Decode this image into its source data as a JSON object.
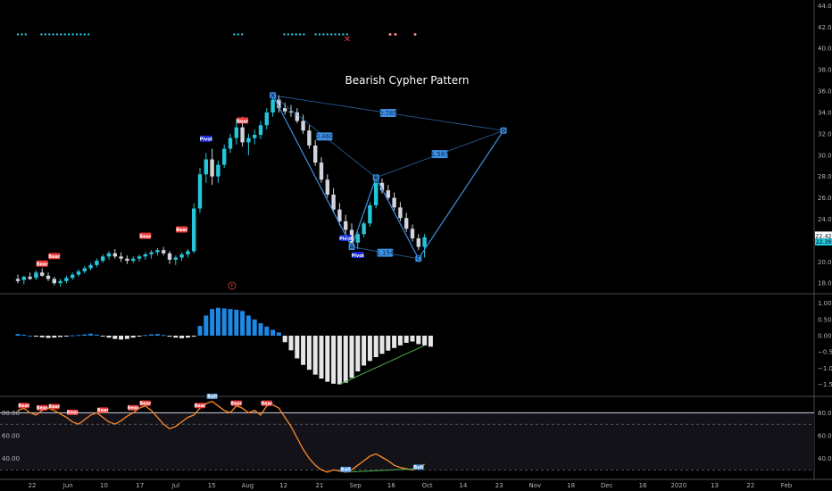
{
  "chart_data": [
    {
      "type": "line",
      "panel": "price",
      "title": "Bearish Cypher Pattern",
      "y_ticks": [
        "44.00",
        "42.00",
        "40.00",
        "38.00",
        "36.00",
        "34.00",
        "32.00",
        "30.00",
        "28.00",
        "26.00",
        "24.00",
        "22.00",
        "20.00",
        "18.00"
      ],
      "ylim": [
        17.6,
        44.2
      ],
      "last_price_label": "22.42",
      "last_price": 22.42,
      "secondary_price_label": "22.39",
      "secondary_price": 22.2,
      "candles": [
        {
          "o": 18.4,
          "h": 18.8,
          "l": 18.0,
          "c": 18.2
        },
        {
          "o": 18.3,
          "h": 18.7,
          "l": 17.9,
          "c": 18.6
        },
        {
          "o": 18.6,
          "h": 19.0,
          "l": 18.3,
          "c": 18.4
        },
        {
          "o": 18.5,
          "h": 19.2,
          "l": 18.3,
          "c": 19.0
        },
        {
          "o": 19.0,
          "h": 19.4,
          "l": 18.6,
          "c": 18.7
        },
        {
          "o": 18.7,
          "h": 19.0,
          "l": 18.2,
          "c": 18.4
        },
        {
          "o": 18.4,
          "h": 18.6,
          "l": 17.8,
          "c": 18.0
        },
        {
          "o": 18.0,
          "h": 18.4,
          "l": 17.7,
          "c": 18.2
        },
        {
          "o": 18.2,
          "h": 18.7,
          "l": 18.0,
          "c": 18.5
        },
        {
          "o": 18.5,
          "h": 19.0,
          "l": 18.3,
          "c": 18.8
        },
        {
          "o": 18.8,
          "h": 19.3,
          "l": 18.6,
          "c": 19.1
        },
        {
          "o": 19.1,
          "h": 19.6,
          "l": 18.9,
          "c": 19.4
        },
        {
          "o": 19.4,
          "h": 19.9,
          "l": 19.2,
          "c": 19.7
        },
        {
          "o": 19.7,
          "h": 20.3,
          "l": 19.5,
          "c": 20.1
        },
        {
          "o": 20.1,
          "h": 20.7,
          "l": 19.9,
          "c": 20.5
        },
        {
          "o": 20.5,
          "h": 21.0,
          "l": 20.2,
          "c": 20.8
        },
        {
          "o": 20.8,
          "h": 21.2,
          "l": 20.3,
          "c": 20.5
        },
        {
          "o": 20.5,
          "h": 20.9,
          "l": 20.0,
          "c": 20.3
        },
        {
          "o": 20.3,
          "h": 20.6,
          "l": 19.8,
          "c": 20.1
        },
        {
          "o": 20.1,
          "h": 20.5,
          "l": 19.9,
          "c": 20.3
        },
        {
          "o": 20.3,
          "h": 20.7,
          "l": 20.0,
          "c": 20.5
        },
        {
          "o": 20.5,
          "h": 20.9,
          "l": 20.2,
          "c": 20.7
        },
        {
          "o": 20.7,
          "h": 21.1,
          "l": 20.3,
          "c": 20.9
        },
        {
          "o": 20.9,
          "h": 21.3,
          "l": 20.6,
          "c": 21.1
        },
        {
          "o": 21.1,
          "h": 21.4,
          "l": 20.6,
          "c": 20.8
        },
        {
          "o": 20.8,
          "h": 21.0,
          "l": 19.8,
          "c": 20.2
        },
        {
          "o": 20.2,
          "h": 20.6,
          "l": 19.7,
          "c": 20.4
        },
        {
          "o": 20.4,
          "h": 20.9,
          "l": 20.1,
          "c": 20.7
        },
        {
          "o": 20.7,
          "h": 21.2,
          "l": 20.4,
          "c": 21.0
        },
        {
          "o": 21.0,
          "h": 25.5,
          "l": 20.8,
          "c": 25.0
        },
        {
          "o": 25.0,
          "h": 28.8,
          "l": 24.6,
          "c": 28.2
        },
        {
          "o": 28.2,
          "h": 30.2,
          "l": 27.4,
          "c": 29.6
        },
        {
          "o": 29.6,
          "h": 30.6,
          "l": 27.2,
          "c": 28.0
        },
        {
          "o": 28.0,
          "h": 29.5,
          "l": 27.4,
          "c": 29.1
        },
        {
          "o": 29.1,
          "h": 31.0,
          "l": 28.8,
          "c": 30.6
        },
        {
          "o": 30.6,
          "h": 32.0,
          "l": 30.2,
          "c": 31.6
        },
        {
          "o": 31.6,
          "h": 33.4,
          "l": 31.0,
          "c": 32.6
        },
        {
          "o": 32.6,
          "h": 33.6,
          "l": 30.8,
          "c": 31.2
        },
        {
          "o": 31.2,
          "h": 32.0,
          "l": 30.0,
          "c": 31.6
        },
        {
          "o": 31.6,
          "h": 32.4,
          "l": 31.0,
          "c": 31.9
        },
        {
          "o": 31.9,
          "h": 33.2,
          "l": 31.5,
          "c": 32.8
        },
        {
          "o": 32.8,
          "h": 34.4,
          "l": 32.4,
          "c": 34.0
        },
        {
          "o": 34.0,
          "h": 35.6,
          "l": 33.6,
          "c": 35.2
        },
        {
          "o": 35.2,
          "h": 35.6,
          "l": 34.0,
          "c": 34.4
        },
        {
          "o": 34.4,
          "h": 34.9,
          "l": 33.8,
          "c": 34.1
        },
        {
          "o": 34.1,
          "h": 34.7,
          "l": 33.6,
          "c": 34.0
        },
        {
          "o": 34.0,
          "h": 34.4,
          "l": 33.0,
          "c": 33.2
        },
        {
          "o": 33.2,
          "h": 33.8,
          "l": 32.0,
          "c": 32.3
        },
        {
          "o": 32.3,
          "h": 32.8,
          "l": 30.6,
          "c": 30.9
        },
        {
          "o": 30.9,
          "h": 31.4,
          "l": 29.0,
          "c": 29.3
        },
        {
          "o": 29.3,
          "h": 29.8,
          "l": 27.4,
          "c": 27.7
        },
        {
          "o": 27.7,
          "h": 28.2,
          "l": 26.0,
          "c": 26.3
        },
        {
          "o": 26.3,
          "h": 26.9,
          "l": 24.6,
          "c": 24.9
        },
        {
          "o": 24.9,
          "h": 25.5,
          "l": 23.4,
          "c": 23.8
        },
        {
          "o": 23.8,
          "h": 24.4,
          "l": 22.6,
          "c": 23.0
        },
        {
          "o": 23.0,
          "h": 23.6,
          "l": 21.4,
          "c": 21.8
        },
        {
          "o": 21.8,
          "h": 22.8,
          "l": 21.2,
          "c": 22.6
        },
        {
          "o": 22.6,
          "h": 23.8,
          "l": 22.3,
          "c": 23.6
        },
        {
          "o": 23.6,
          "h": 25.6,
          "l": 23.3,
          "c": 25.3
        },
        {
          "o": 25.3,
          "h": 27.8,
          "l": 25.0,
          "c": 27.4
        },
        {
          "o": 27.4,
          "h": 27.8,
          "l": 26.4,
          "c": 26.7
        },
        {
          "o": 26.7,
          "h": 27.2,
          "l": 25.8,
          "c": 26.0
        },
        {
          "o": 26.0,
          "h": 26.5,
          "l": 24.8,
          "c": 25.1
        },
        {
          "o": 25.1,
          "h": 25.6,
          "l": 23.8,
          "c": 24.1
        },
        {
          "o": 24.1,
          "h": 24.6,
          "l": 22.8,
          "c": 23.1
        },
        {
          "o": 23.1,
          "h": 23.5,
          "l": 21.9,
          "c": 22.2
        },
        {
          "o": 22.2,
          "h": 22.6,
          "l": 21.1,
          "c": 21.4
        },
        {
          "o": 21.4,
          "h": 22.6,
          "l": 20.4,
          "c": 22.3
        }
      ],
      "pattern": {
        "points": [
          {
            "label": "X",
            "i": 42,
            "y": 35.6
          },
          {
            "label": "A",
            "i": 55,
            "y": 21.4
          },
          {
            "label": "B",
            "i": 59,
            "y": 27.9
          },
          {
            "label": "C",
            "i": 66,
            "y": 20.3
          },
          {
            "label": "D",
            "i": 80,
            "y": 32.3
          }
        ],
        "ratios": [
          {
            "label": "0.460",
            "from": 0,
            "to": 2
          },
          {
            "label": "1.154",
            "from": 1,
            "to": 3
          },
          {
            "label": "1.587",
            "from": 2,
            "to": 4
          },
          {
            "label": "0.785",
            "from": 0,
            "to": 4
          }
        ]
      },
      "signal_tags": [
        {
          "label": "Bear",
          "i": 4,
          "y": 19.8,
          "kind": "bear"
        },
        {
          "label": "Bear",
          "i": 6,
          "y": 20.5,
          "kind": "bear"
        },
        {
          "label": "Bear",
          "i": 21,
          "y": 22.4,
          "kind": "bear"
        },
        {
          "label": "Bear",
          "i": 27,
          "y": 23.0,
          "kind": "bear"
        },
        {
          "label": "Pivot",
          "i": 31,
          "y": 31.5,
          "kind": "pivot"
        },
        {
          "label": "Bear",
          "i": 37,
          "y": 33.2,
          "kind": "bear"
        },
        {
          "label": "Pivot",
          "i": 54,
          "y": 22.2,
          "kind": "pivot"
        },
        {
          "label": "Pivot",
          "i": 56,
          "y": 20.6,
          "kind": "pivot"
        }
      ]
    },
    {
      "type": "bar",
      "panel": "histogram",
      "y_ticks": [
        "1.00",
        "0.50",
        "0.00",
        "−0.50",
        "−1.00",
        "−1.50"
      ],
      "ylim": [
        -1.65,
        1.1
      ],
      "values": [
        0.05,
        0.03,
        0.0,
        -0.03,
        -0.05,
        -0.07,
        -0.06,
        -0.04,
        -0.02,
        0.01,
        0.02,
        0.04,
        0.06,
        0.03,
        -0.02,
        -0.06,
        -0.1,
        -0.12,
        -0.1,
        -0.06,
        -0.02,
        0.02,
        0.04,
        0.05,
        0.02,
        -0.03,
        -0.06,
        -0.08,
        -0.06,
        -0.03,
        0.3,
        0.62,
        0.82,
        0.86,
        0.84,
        0.82,
        0.8,
        0.76,
        0.62,
        0.5,
        0.38,
        0.28,
        0.18,
        0.1,
        -0.2,
        -0.45,
        -0.7,
        -0.9,
        -1.05,
        -1.2,
        -1.32,
        -1.42,
        -1.48,
        -1.5,
        -1.45,
        -1.3,
        -1.1,
        -0.92,
        -0.78,
        -0.66,
        -0.56,
        -0.46,
        -0.38,
        -0.3,
        -0.22,
        -0.18,
        -0.26,
        -0.3,
        -0.34
      ],
      "divergence": {
        "from": 53,
        "to": 67
      }
    },
    {
      "type": "line",
      "panel": "rsi",
      "y_ticks": [
        "80.00",
        "60.00",
        "40.00"
      ],
      "ylim": [
        24,
        92
      ],
      "upper_level": 80,
      "mid_high": 70,
      "low_level": 30,
      "values": [
        82,
        84,
        80,
        78,
        82,
        84,
        82,
        79,
        76,
        72,
        70,
        74,
        78,
        80,
        76,
        72,
        70,
        73,
        77,
        80,
        84,
        86,
        82,
        76,
        70,
        66,
        68,
        72,
        76,
        78,
        84,
        88,
        90,
        86,
        82,
        80,
        86,
        84,
        80,
        82,
        78,
        86,
        87,
        84,
        76,
        68,
        58,
        48,
        40,
        34,
        30,
        28,
        30,
        29,
        28,
        30,
        34,
        38,
        42,
        44,
        41,
        38,
        34,
        32,
        31,
        30,
        32,
        35
      ],
      "tags": [
        {
          "label": "Bear",
          "i": 1,
          "v": 84,
          "kind": "bear"
        },
        {
          "label": "Bear",
          "i": 4,
          "v": 82,
          "kind": "bear"
        },
        {
          "label": "Bear",
          "i": 6,
          "v": 83,
          "kind": "bear"
        },
        {
          "label": "Bear",
          "i": 9,
          "v": 78,
          "kind": "bear"
        },
        {
          "label": "Bear",
          "i": 14,
          "v": 80,
          "kind": "bear"
        },
        {
          "label": "Bear",
          "i": 19,
          "v": 82,
          "kind": "bear"
        },
        {
          "label": "Bear",
          "i": 21,
          "v": 86,
          "kind": "bear"
        },
        {
          "label": "Bear",
          "i": 30,
          "v": 84,
          "kind": "bear"
        },
        {
          "label": "Bear",
          "i": 36,
          "v": 86,
          "kind": "bear"
        },
        {
          "label": "Bear",
          "i": 41,
          "v": 86,
          "kind": "bear"
        },
        {
          "label": "Bull",
          "i": 32,
          "v": 92,
          "kind": "bull"
        },
        {
          "label": "Bull",
          "i": 54,
          "v": 28,
          "kind": "bull"
        },
        {
          "label": "Bull",
          "i": 66,
          "v": 30,
          "kind": "bull"
        }
      ]
    }
  ],
  "x_axis": {
    "labels": [
      "22",
      "Jun",
      "10",
      "17",
      "Jul",
      "15",
      "Aug",
      "12",
      "21",
      "Sep",
      "16",
      "Oct",
      "14",
      "23",
      "Nov",
      "18",
      "Dec",
      "16",
      "2020",
      "13",
      "22",
      "Feb"
    ]
  },
  "markers": {
    "x_symbol": "✕",
    "f_symbol": "F"
  },
  "colors": {
    "bull": "#26c6da",
    "bear": "#d1d4dc",
    "pattern": "#3d8ee0",
    "rsi": "#ff8a2a",
    "tag_bear": "#ef3b3b",
    "tag_pivot": "#1a2bd6",
    "hist_pos": "#1e88e5",
    "hist_neg": "#e6e6e6",
    "divergence": "#4caf50"
  }
}
